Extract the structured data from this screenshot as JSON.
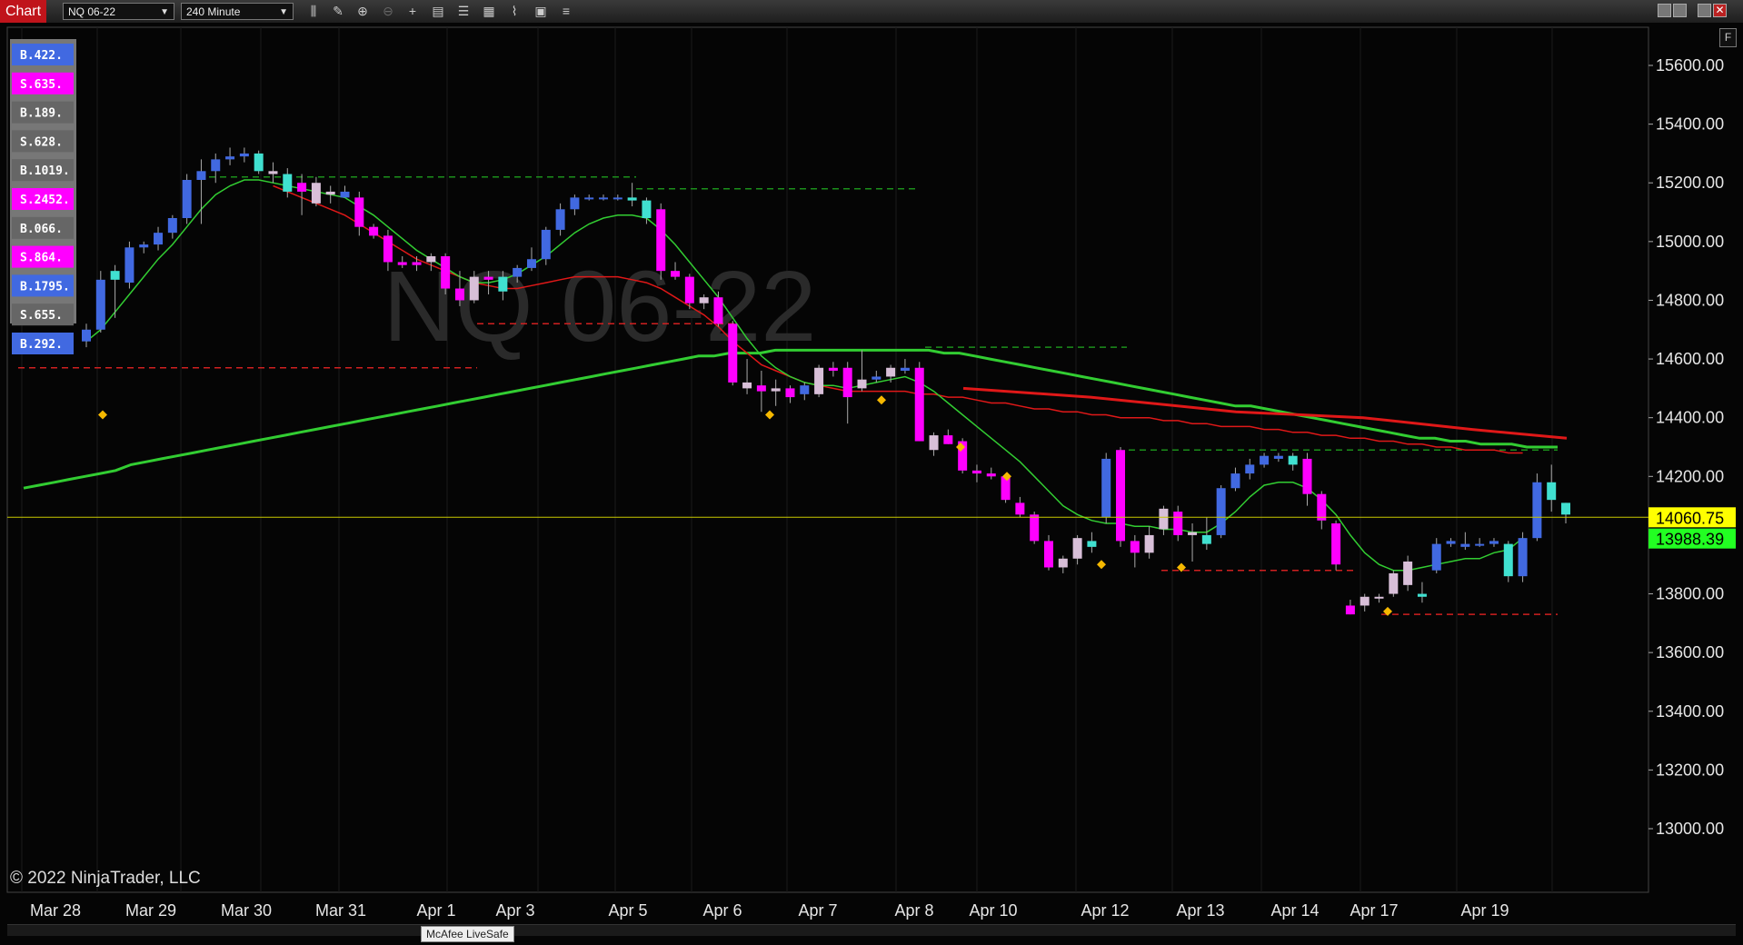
{
  "toolbar": {
    "tab_label": "Chart",
    "instrument": "NQ 06-22",
    "interval": "240 Minute",
    "icons": [
      "bar-type-icon",
      "draw-icon",
      "zoom-in-icon",
      "zoom-out-icon",
      "crosshair-icon",
      "data-box-icon",
      "properties-icon",
      "strategies-icon",
      "indicators-icon",
      "templates-icon",
      "list-icon"
    ]
  },
  "watermark": "NQ 06-22",
  "copyright": "© 2022 NinjaTrader, LLC",
  "tooltip": "McAfee LiveSafe",
  "f_button": "F",
  "colors": {
    "up": "#4169e1",
    "down": "#ff00ff",
    "up_alt": "#40e0d0",
    "neutral": "#d8bfd8",
    "fast_ma": "#32cd32",
    "slow_ma": "#e01818",
    "price_line": "#c8c800",
    "last": "#ffff00",
    "bid": "#22ff22"
  },
  "price_axis": {
    "labels": [
      "15600.00",
      "15400.00",
      "15200.00",
      "15000.00",
      "14800.00",
      "14600.00",
      "14400.00",
      "14200.00",
      "13800.00",
      "13600.00",
      "13400.00",
      "13200.00",
      "13000.00"
    ],
    "min": 12900,
    "max": 15800
  },
  "price_markers": {
    "last": "14060.75",
    "bid": "13988.39"
  },
  "date_axis": [
    "Mar 28",
    "Mar 29",
    "Mar 30",
    "Mar 31",
    "Apr 1",
    "Apr 3",
    "Apr 5",
    "Apr 6",
    "Apr 7",
    "Apr 8",
    "Apr 10",
    "Apr 12",
    "Apr 13",
    "Apr 14",
    "Apr 17",
    "Apr 19"
  ],
  "order_flow_labels": [
    {
      "text": "B.422.",
      "color": "#4169e1"
    },
    {
      "text": "S.635.",
      "color": "#ff00ff"
    },
    {
      "text": "B.189.",
      "color": "#666666"
    },
    {
      "text": "S.628.",
      "color": "#666666"
    },
    {
      "text": "B.1019.",
      "color": "#666666"
    },
    {
      "text": "S.2452.",
      "color": "#ff00ff"
    },
    {
      "text": "B.066.",
      "color": "#666666"
    },
    {
      "text": "S.864.",
      "color": "#ff00ff"
    },
    {
      "text": "B.1795.",
      "color": "#4169e1"
    },
    {
      "text": "S.655.",
      "color": "#666666"
    },
    {
      "text": "B.292.",
      "color": "#4169e1"
    }
  ],
  "chart_data": {
    "type": "candlestick",
    "instrument": "NQ 06-22",
    "interval": "240 Minute",
    "ylim": [
      12900,
      15800
    ],
    "candles": [
      {
        "o": 14660,
        "h": 14720,
        "l": 14640,
        "c": 14700,
        "col": "up"
      },
      {
        "o": 14700,
        "h": 14900,
        "l": 14690,
        "c": 14870,
        "col": "up"
      },
      {
        "o": 14870,
        "h": 14920,
        "l": 14740,
        "c": 14900,
        "col": "up_alt"
      },
      {
        "o": 14860,
        "h": 15000,
        "l": 14840,
        "c": 14980,
        "col": "up"
      },
      {
        "o": 14980,
        "h": 15000,
        "l": 14960,
        "c": 14990,
        "col": "up"
      },
      {
        "o": 14990,
        "h": 15050,
        "l": 14970,
        "c": 15030,
        "col": "up"
      },
      {
        "o": 15030,
        "h": 15090,
        "l": 15010,
        "c": 15080,
        "col": "up"
      },
      {
        "o": 15080,
        "h": 15230,
        "l": 15060,
        "c": 15210,
        "col": "up"
      },
      {
        "o": 15210,
        "h": 15280,
        "l": 15060,
        "c": 15240,
        "col": "up"
      },
      {
        "o": 15240,
        "h": 15300,
        "l": 15200,
        "c": 15280,
        "col": "up"
      },
      {
        "o": 15280,
        "h": 15320,
        "l": 15260,
        "c": 15290,
        "col": "up"
      },
      {
        "o": 15290,
        "h": 15320,
        "l": 15270,
        "c": 15300,
        "col": "up"
      },
      {
        "o": 15300,
        "h": 15310,
        "l": 15230,
        "c": 15240,
        "col": "up_alt"
      },
      {
        "o": 15240,
        "h": 15270,
        "l": 15200,
        "c": 15230,
        "col": "neutral"
      },
      {
        "o": 15230,
        "h": 15250,
        "l": 15150,
        "c": 15170,
        "col": "up_alt"
      },
      {
        "o": 15170,
        "h": 15230,
        "l": 15090,
        "c": 15200,
        "col": "down"
      },
      {
        "o": 15200,
        "h": 15220,
        "l": 15120,
        "c": 15130,
        "col": "neutral"
      },
      {
        "o": 15160,
        "h": 15190,
        "l": 15130,
        "c": 15170,
        "col": "neutral"
      },
      {
        "o": 15170,
        "h": 15190,
        "l": 15150,
        "c": 15150,
        "col": "up"
      },
      {
        "o": 15150,
        "h": 15170,
        "l": 15020,
        "c": 15050,
        "col": "down"
      },
      {
        "o": 15050,
        "h": 15060,
        "l": 15010,
        "c": 15020,
        "col": "down"
      },
      {
        "o": 15020,
        "h": 15040,
        "l": 14900,
        "c": 14930,
        "col": "down"
      },
      {
        "o": 14930,
        "h": 14950,
        "l": 14910,
        "c": 14920,
        "col": "down"
      },
      {
        "o": 14920,
        "h": 14950,
        "l": 14900,
        "c": 14930,
        "col": "down"
      },
      {
        "o": 14930,
        "h": 14960,
        "l": 14900,
        "c": 14950,
        "col": "neutral"
      },
      {
        "o": 14950,
        "h": 14960,
        "l": 14820,
        "c": 14840,
        "col": "down"
      },
      {
        "o": 14840,
        "h": 14900,
        "l": 14780,
        "c": 14800,
        "col": "down"
      },
      {
        "o": 14800,
        "h": 14900,
        "l": 14790,
        "c": 14880,
        "col": "neutral"
      },
      {
        "o": 14880,
        "h": 14900,
        "l": 14820,
        "c": 14870,
        "col": "down"
      },
      {
        "o": 14830,
        "h": 14900,
        "l": 14800,
        "c": 14880,
        "col": "up_alt"
      },
      {
        "o": 14880,
        "h": 14920,
        "l": 14860,
        "c": 14910,
        "col": "up"
      },
      {
        "o": 14910,
        "h": 14980,
        "l": 14900,
        "c": 14940,
        "col": "up"
      },
      {
        "o": 14940,
        "h": 15050,
        "l": 14920,
        "c": 15040,
        "col": "up"
      },
      {
        "o": 15040,
        "h": 15130,
        "l": 15020,
        "c": 15110,
        "col": "up"
      },
      {
        "o": 15110,
        "h": 15160,
        "l": 15090,
        "c": 15150,
        "col": "up"
      },
      {
        "o": 15150,
        "h": 15160,
        "l": 15140,
        "c": 15150,
        "col": "up"
      },
      {
        "o": 15150,
        "h": 15160,
        "l": 15140,
        "c": 15150,
        "col": "up"
      },
      {
        "o": 15150,
        "h": 15160,
        "l": 15140,
        "c": 15150,
        "col": "up"
      },
      {
        "o": 15150,
        "h": 15200,
        "l": 15120,
        "c": 15140,
        "col": "up_alt"
      },
      {
        "o": 15140,
        "h": 15150,
        "l": 15060,
        "c": 15080,
        "col": "up_alt"
      },
      {
        "o": 15110,
        "h": 15130,
        "l": 14870,
        "c": 14900,
        "col": "down"
      },
      {
        "o": 14900,
        "h": 14930,
        "l": 14870,
        "c": 14880,
        "col": "down"
      },
      {
        "o": 14880,
        "h": 14890,
        "l": 14770,
        "c": 14790,
        "col": "down"
      },
      {
        "o": 14790,
        "h": 14820,
        "l": 14770,
        "c": 14810,
        "col": "neutral"
      },
      {
        "o": 14810,
        "h": 14830,
        "l": 14710,
        "c": 14720,
        "col": "down"
      },
      {
        "o": 14720,
        "h": 14730,
        "l": 14510,
        "c": 14520,
        "col": "down"
      },
      {
        "o": 14520,
        "h": 14600,
        "l": 14480,
        "c": 14500,
        "col": "neutral"
      },
      {
        "o": 14510,
        "h": 14560,
        "l": 14420,
        "c": 14490,
        "col": "down"
      },
      {
        "o": 14490,
        "h": 14530,
        "l": 14440,
        "c": 14500,
        "col": "neutral"
      },
      {
        "o": 14500,
        "h": 14510,
        "l": 14450,
        "c": 14470,
        "col": "down"
      },
      {
        "o": 14480,
        "h": 14520,
        "l": 14460,
        "c": 14510,
        "col": "up"
      },
      {
        "o": 14480,
        "h": 14580,
        "l": 14470,
        "c": 14570,
        "col": "neutral"
      },
      {
        "o": 14570,
        "h": 14590,
        "l": 14540,
        "c": 14560,
        "col": "down"
      },
      {
        "o": 14570,
        "h": 14590,
        "l": 14380,
        "c": 14470,
        "col": "down"
      },
      {
        "o": 14500,
        "h": 14630,
        "l": 14490,
        "c": 14530,
        "col": "neutral"
      },
      {
        "o": 14530,
        "h": 14560,
        "l": 14520,
        "c": 14540,
        "col": "up"
      },
      {
        "o": 14540,
        "h": 14580,
        "l": 14520,
        "c": 14570,
        "col": "neutral"
      },
      {
        "o": 14570,
        "h": 14600,
        "l": 14550,
        "c": 14560,
        "col": "up"
      },
      {
        "o": 14570,
        "h": 14590,
        "l": 14320,
        "c": 14320,
        "col": "down"
      },
      {
        "o": 14340,
        "h": 14350,
        "l": 14270,
        "c": 14290,
        "col": "neutral"
      },
      {
        "o": 14340,
        "h": 14360,
        "l": 14310,
        "c": 14310,
        "col": "down"
      },
      {
        "o": 14320,
        "h": 14330,
        "l": 14210,
        "c": 14220,
        "col": "down"
      },
      {
        "o": 14220,
        "h": 14240,
        "l": 14180,
        "c": 14210,
        "col": "down"
      },
      {
        "o": 14210,
        "h": 14230,
        "l": 14190,
        "c": 14200,
        "col": "down"
      },
      {
        "o": 14200,
        "h": 14210,
        "l": 14110,
        "c": 14120,
        "col": "down"
      },
      {
        "o": 14110,
        "h": 14130,
        "l": 14060,
        "c": 14070,
        "col": "down"
      },
      {
        "o": 14070,
        "h": 14080,
        "l": 13970,
        "c": 13980,
        "col": "down"
      },
      {
        "o": 13980,
        "h": 14000,
        "l": 13880,
        "c": 13890,
        "col": "down"
      },
      {
        "o": 13890,
        "h": 13930,
        "l": 13870,
        "c": 13920,
        "col": "neutral"
      },
      {
        "o": 13920,
        "h": 14000,
        "l": 13900,
        "c": 13990,
        "col": "neutral"
      },
      {
        "o": 13960,
        "h": 14010,
        "l": 13940,
        "c": 13980,
        "col": "up_alt"
      },
      {
        "o": 14060,
        "h": 14280,
        "l": 14040,
        "c": 14260,
        "col": "up"
      },
      {
        "o": 14290,
        "h": 14300,
        "l": 13960,
        "c": 13980,
        "col": "down"
      },
      {
        "o": 13980,
        "h": 14000,
        "l": 13890,
        "c": 13940,
        "col": "down"
      },
      {
        "o": 13940,
        "h": 14030,
        "l": 13920,
        "c": 14000,
        "col": "neutral"
      },
      {
        "o": 14020,
        "h": 14100,
        "l": 14000,
        "c": 14090,
        "col": "neutral"
      },
      {
        "o": 14080,
        "h": 14100,
        "l": 13980,
        "c": 14000,
        "col": "down"
      },
      {
        "o": 14000,
        "h": 14040,
        "l": 13910,
        "c": 14010,
        "col": "neutral"
      },
      {
        "o": 13970,
        "h": 14060,
        "l": 13950,
        "c": 14000,
        "col": "up_alt"
      },
      {
        "o": 14000,
        "h": 14170,
        "l": 13990,
        "c": 14160,
        "col": "up"
      },
      {
        "o": 14160,
        "h": 14230,
        "l": 14150,
        "c": 14210,
        "col": "up"
      },
      {
        "o": 14210,
        "h": 14260,
        "l": 14190,
        "c": 14240,
        "col": "up"
      },
      {
        "o": 14240,
        "h": 14280,
        "l": 14230,
        "c": 14270,
        "col": "up"
      },
      {
        "o": 14270,
        "h": 14280,
        "l": 14250,
        "c": 14260,
        "col": "up"
      },
      {
        "o": 14270,
        "h": 14280,
        "l": 14220,
        "c": 14240,
        "col": "up_alt"
      },
      {
        "o": 14260,
        "h": 14280,
        "l": 14100,
        "c": 14140,
        "col": "down"
      },
      {
        "o": 14140,
        "h": 14150,
        "l": 14020,
        "c": 14050,
        "col": "down"
      },
      {
        "o": 14040,
        "h": 14050,
        "l": 13880,
        "c": 13900,
        "col": "down"
      },
      {
        "o": 13760,
        "h": 13780,
        "l": 13730,
        "c": 13730,
        "col": "down"
      },
      {
        "o": 13760,
        "h": 13800,
        "l": 13740,
        "c": 13790,
        "col": "neutral"
      },
      {
        "o": 13790,
        "h": 13800,
        "l": 13770,
        "c": 13790,
        "col": "neutral"
      },
      {
        "o": 13800,
        "h": 13880,
        "l": 13790,
        "c": 13870,
        "col": "neutral"
      },
      {
        "o": 13830,
        "h": 13930,
        "l": 13810,
        "c": 13910,
        "col": "neutral"
      },
      {
        "o": 13790,
        "h": 13840,
        "l": 13770,
        "c": 13800,
        "col": "up_alt"
      },
      {
        "o": 13880,
        "h": 13990,
        "l": 13870,
        "c": 13970,
        "col": "up"
      },
      {
        "o": 13970,
        "h": 13990,
        "l": 13960,
        "c": 13980,
        "col": "up"
      },
      {
        "o": 13970,
        "h": 14010,
        "l": 13950,
        "c": 13960,
        "col": "up"
      },
      {
        "o": 13970,
        "h": 13990,
        "l": 13960,
        "c": 13970,
        "col": "up"
      },
      {
        "o": 13970,
        "h": 13990,
        "l": 13960,
        "c": 13980,
        "col": "up"
      },
      {
        "o": 13970,
        "h": 13980,
        "l": 13840,
        "c": 13860,
        "col": "up_alt"
      },
      {
        "o": 13860,
        "h": 14010,
        "l": 13840,
        "c": 13990,
        "col": "up"
      },
      {
        "o": 13990,
        "h": 14210,
        "l": 13980,
        "c": 14180,
        "col": "up"
      },
      {
        "o": 14180,
        "h": 14240,
        "l": 14080,
        "c": 14120,
        "col": "up_alt"
      },
      {
        "o": 14110,
        "h": 14110,
        "l": 14040,
        "c": 14070,
        "col": "up_alt"
      }
    ],
    "fast_ma": [
      14660,
      14700,
      14760,
      14820,
      14880,
      14940,
      14990,
      15050,
      15110,
      15160,
      15190,
      15210,
      15210,
      15200,
      15190,
      15180,
      15170,
      15160,
      15150,
      15120,
      15090,
      15050,
      15010,
      14970,
      14940,
      14910,
      14880,
      14860,
      14860,
      14870,
      14890,
      14920,
      14950,
      14990,
      15030,
      15060,
      15080,
      15090,
      15090,
      15080,
      15040,
      14990,
      14930,
      14870,
      14810,
      14740,
      14670,
      14610,
      14570,
      14540,
      14520,
      14510,
      14510,
      14500,
      14510,
      14520,
      14530,
      14540,
      14520,
      14490,
      14450,
      14410,
      14370,
      14330,
      14290,
      14250,
      14200,
      14150,
      14100,
      14070,
      14050,
      14040,
      14040,
      14030,
      14030,
      14020,
      14020,
      14010,
      14010,
      14040,
      14080,
      14130,
      14170,
      14180,
      14180,
      14160,
      14120,
      14070,
      14000,
      13940,
      13900,
      13880,
      13880,
      13890,
      13900,
      13910,
      13920,
      13920,
      13940,
      13950,
      13990
    ],
    "slow_ma": [
      null,
      null,
      null,
      null,
      null,
      null,
      null,
      null,
      null,
      null,
      null,
      null,
      null,
      15190,
      15170,
      15150,
      15130,
      15110,
      15090,
      15060,
      15030,
      15000,
      14970,
      14940,
      14920,
      14900,
      14880,
      14860,
      14850,
      14840,
      14840,
      14850,
      14860,
      14870,
      14880,
      14880,
      14880,
      14880,
      14870,
      14860,
      14840,
      14810,
      14780,
      14750,
      14710,
      14660,
      14620,
      14580,
      14560,
      14540,
      14520,
      14510,
      14500,
      14490,
      14490,
      14490,
      14490,
      14490,
      14480,
      14480,
      14470,
      14470,
      14460,
      14450,
      14450,
      14440,
      14430,
      14430,
      14420,
      14420,
      14410,
      14410,
      14400,
      14400,
      14400,
      14390,
      14390,
      14380,
      14380,
      14370,
      14370,
      14370,
      14360,
      14360,
      14350,
      14350,
      14340,
      14340,
      14330,
      14330,
      14320,
      14320,
      14310,
      14310,
      14300,
      14300,
      14290,
      14290,
      14290,
      14280,
      14280
    ],
    "long_ma": [
      14160,
      14170,
      14180,
      14190,
      14200,
      14210,
      14220,
      14240,
      14250,
      14260,
      14270,
      14280,
      14290,
      14300,
      14310,
      14320,
      14330,
      14340,
      14350,
      14360,
      14370,
      14380,
      14390,
      14400,
      14410,
      14420,
      14430,
      14440,
      14450,
      14460,
      14470,
      14480,
      14490,
      14500,
      14510,
      14520,
      14530,
      14540,
      14550,
      14560,
      14570,
      14580,
      14590,
      14600,
      14610,
      14610,
      14620,
      14620,
      14620,
      14630,
      14630,
      14630,
      14630,
      14630,
      14630,
      14630,
      14630,
      14630,
      14630,
      14630,
      14620,
      14620,
      14610,
      14600,
      14590,
      14580,
      14570,
      14560,
      14550,
      14540,
      14530,
      14520,
      14510,
      14500,
      14490,
      14480,
      14470,
      14460,
      14450,
      14440,
      14440,
      14430,
      14420,
      14410,
      14400,
      14390,
      14380,
      14370,
      14360,
      14350,
      14340,
      14330,
      14330,
      14320,
      14320,
      14310,
      14310,
      14310,
      14300,
      14300,
      14300
    ],
    "last_price": 14060.75,
    "bid_price": 13988.39
  }
}
